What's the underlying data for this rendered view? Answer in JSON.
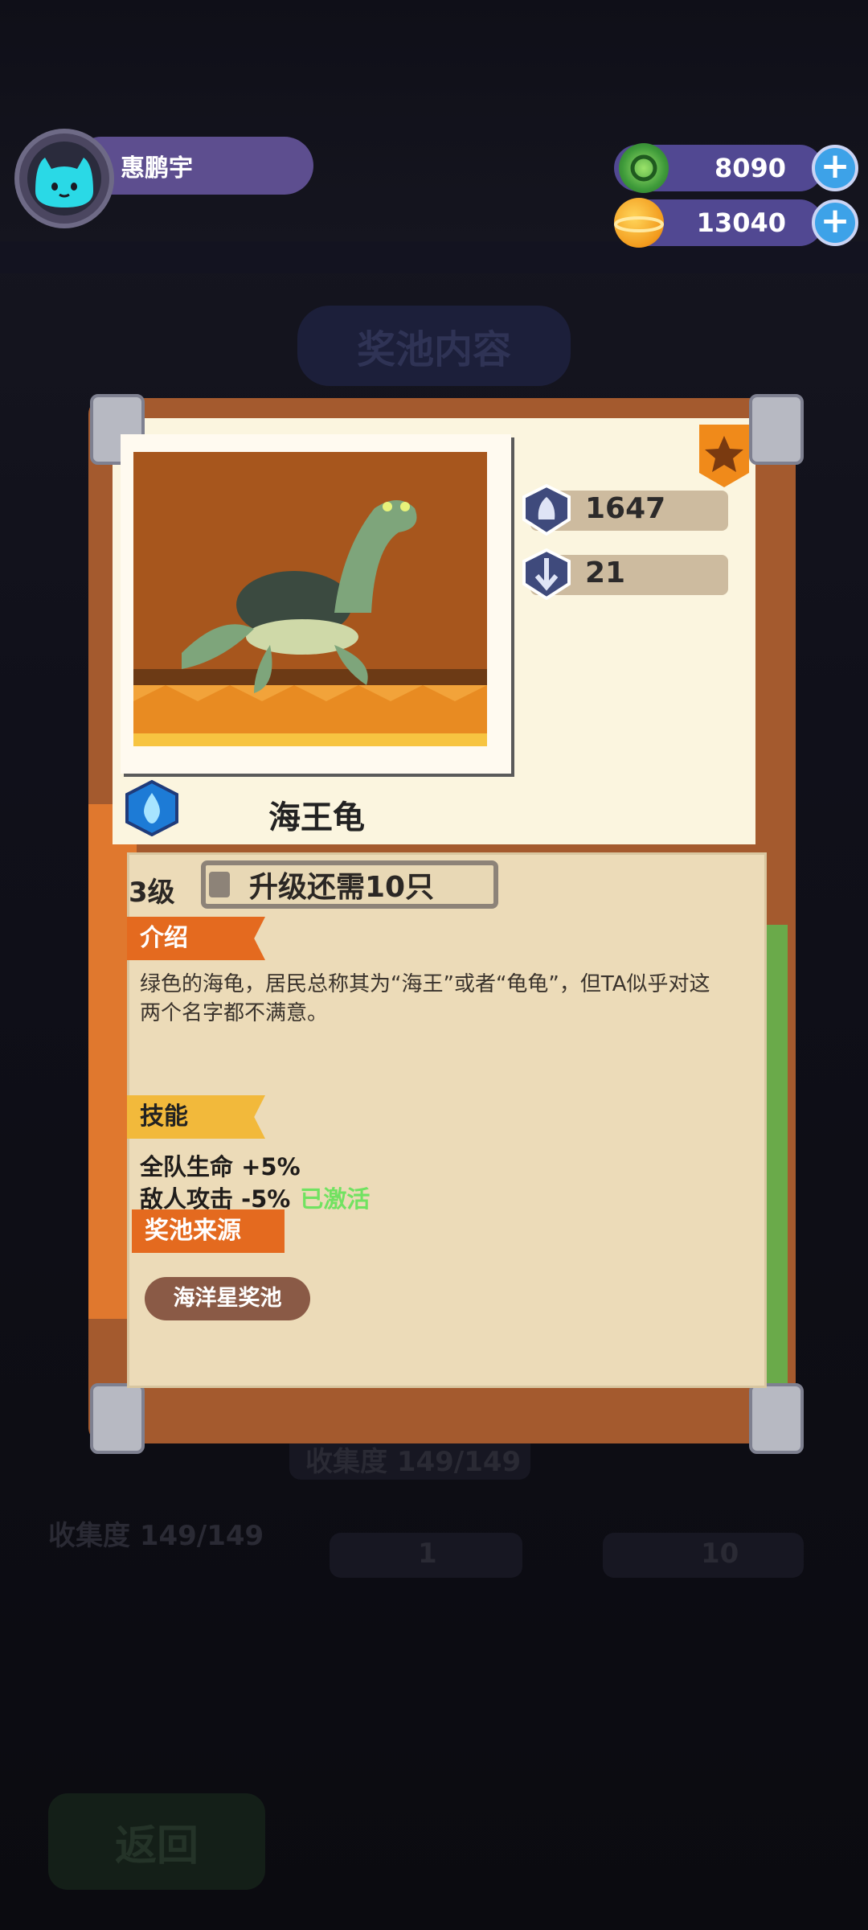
{
  "user": {
    "name": "惠鹏宇"
  },
  "currencies": [
    {
      "icon": "green-gem-icon",
      "amount": "8090"
    },
    {
      "icon": "gold-planet-icon",
      "amount": "13040"
    }
  ],
  "background": {
    "panel_title": "奖池内容",
    "collection_label": "收集度 149/149",
    "collection_label_left": "收集度 149/149",
    "count_1": "1",
    "count_10": "10",
    "back_label": "返回"
  },
  "card": {
    "stats": [
      {
        "icon": "hp-shield-icon",
        "value": "1647"
      },
      {
        "icon": "attack-shield-icon",
        "value": "21"
      }
    ],
    "element_icon": "water-drop-icon",
    "name": "海王龟",
    "level": "3级",
    "upgrade_text": "升级还需10只",
    "intro_label": "介绍",
    "intro_text": "绿色的海龟，居民总称其为“海王”或者“龟龟”，但TA似乎对这两个名字都不满意。",
    "skill_label": "技能",
    "skill_1": "全队生命 +5%",
    "skill_2": "敌人攻击 -5%",
    "skill_status": "已激活",
    "source_label": "奖池来源",
    "source_chip": "海洋星奖池",
    "colors": {
      "paper": "#fbf5df",
      "tag_orange": "#e46a1f",
      "tag_yellow": "#f2b93b",
      "active_green": "#71e261"
    }
  }
}
